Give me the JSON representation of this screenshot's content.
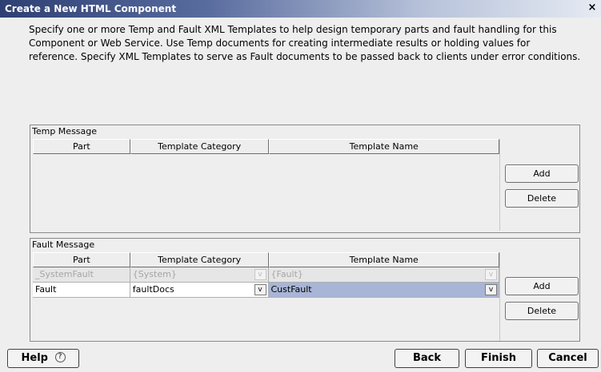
{
  "window": {
    "title": "Create a New HTML Component",
    "close_glyph": "×"
  },
  "description": "Specify one or more Temp and Fault XML Templates to help design temporary parts and fault handling for this Component or Web Service.  Use Temp documents for creating intermediate results or holding values for reference. Specify XML Templates to serve as Fault documents to be passed back to clients under error conditions.",
  "temp_message": {
    "label": "Temp Message",
    "columns": [
      "Part",
      "Template Category",
      "Template Name"
    ],
    "rows": [],
    "add_label": "Add",
    "delete_label": "Delete"
  },
  "fault_message": {
    "label": "Fault Message",
    "columns": [
      "Part",
      "Template Category",
      "Template Name"
    ],
    "rows": [
      {
        "part": "_SystemFault",
        "category": "{System}",
        "name": "{Fault}",
        "disabled": true
      },
      {
        "part": "Fault",
        "category": "faultDocs",
        "name": "CustFault",
        "disabled": false
      }
    ],
    "add_label": "Add",
    "delete_label": "Delete"
  },
  "dropdown_glyph": "v",
  "footer": {
    "help_label": "Help",
    "help_icon_glyph": "?",
    "back_label": "Back",
    "finish_label": "Finish",
    "cancel_label": "Cancel"
  },
  "colors": {
    "title_gradient_start": "#2e3f73",
    "selection": "#a8b5d6",
    "dialog_bg": "#eeeeee"
  }
}
